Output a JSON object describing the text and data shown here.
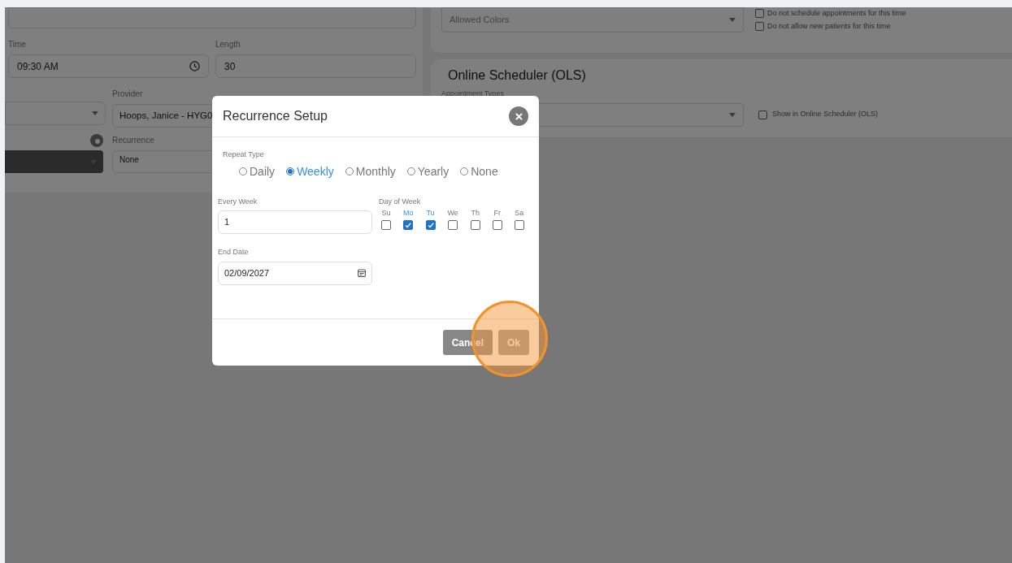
{
  "form": {
    "time": {
      "label": "Time",
      "value": "09:30 AM"
    },
    "length": {
      "label": "Length",
      "value": "30"
    },
    "provider": {
      "label": "Provider",
      "value": "Hoops, Janice - HYG0"
    },
    "recurrence": {
      "label": "Recurrence",
      "value": "None"
    }
  },
  "options_panel": {
    "colors": {
      "placeholder": "Allowed Colors"
    },
    "checkboxes": [
      {
        "label": "Do not schedule appointments for this time",
        "checked": false
      },
      {
        "label": "Do not allow new patients for this time",
        "checked": false
      }
    ]
  },
  "ols_panel": {
    "title": "Online Scheduler (OLS)",
    "appointment_types": {
      "label": "Appointment Types"
    },
    "checkbox": {
      "label": "Show in Online Scheduler (OLS)",
      "checked": false
    }
  },
  "dialog": {
    "title": "Recurrence Setup",
    "repeat_type": {
      "label": "Repeat Type",
      "options": [
        {
          "label": "Daily",
          "selected": false
        },
        {
          "label": "Weekly",
          "selected": true
        },
        {
          "label": "Monthly",
          "selected": false
        },
        {
          "label": "Yearly",
          "selected": false
        },
        {
          "label": "None",
          "selected": false
        }
      ]
    },
    "every_week": {
      "label": "Every Week",
      "value": "1"
    },
    "day_of_week": {
      "label": "Day of Week",
      "days": [
        {
          "label": "Su",
          "checked": false
        },
        {
          "label": "Mo",
          "checked": true
        },
        {
          "label": "Tu",
          "checked": true
        },
        {
          "label": "We",
          "checked": false
        },
        {
          "label": "Th",
          "checked": false
        },
        {
          "label": "Fr",
          "checked": false
        },
        {
          "label": "Sa",
          "checked": false
        }
      ]
    },
    "end_date": {
      "label": "End Date",
      "value": "02/09/2027"
    },
    "buttons": [
      "Cancel",
      "Ok"
    ]
  }
}
